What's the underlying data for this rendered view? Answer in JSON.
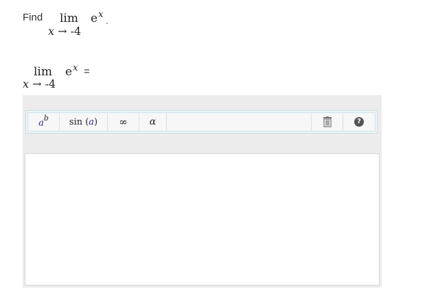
{
  "question": {
    "find_word": "Find",
    "lim_word": "lim",
    "variable": "x",
    "arrow": "→",
    "approach_value": "-4",
    "base": "e",
    "exponent": "x",
    "period": "."
  },
  "answer": {
    "lim_word": "lim",
    "variable": "x",
    "arrow": "→",
    "approach_value": "-4",
    "base": "e",
    "exponent": "x",
    "equals": "="
  },
  "toolbar": {
    "power": {
      "base": "a",
      "exponent": "b",
      "icon": "power-icon"
    },
    "function": {
      "name": "sin",
      "open": "(",
      "arg": "a",
      "close": ")"
    },
    "infinity": {
      "symbol": "∞"
    },
    "greek": {
      "symbol": "α"
    },
    "trash": {
      "icon": "trash-icon"
    },
    "help": {
      "symbol": "?",
      "icon": "help-icon"
    }
  },
  "colors": {
    "editor_bg": "#ececec",
    "toolbar_border": "#bfe0ea",
    "placeholder_letter": "#2c1a8f"
  }
}
